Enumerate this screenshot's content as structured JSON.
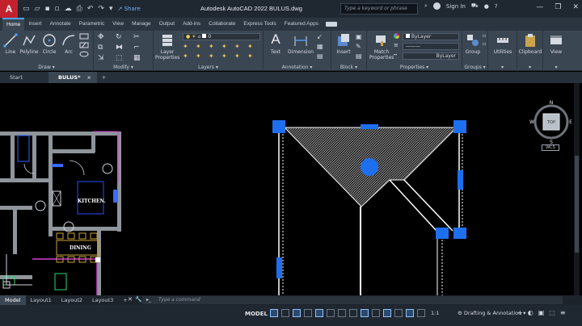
{
  "titlebar": {
    "app_letter": "A",
    "share": "Share",
    "title": "Autodesk AutoCAD 2022   BULUS.dwg",
    "search_placeholder": "Type a keyword or phrase",
    "sign_in": "Sign In",
    "min": "—",
    "max": "❐",
    "close": "✕"
  },
  "menu": {
    "tabs": [
      "Home",
      "Insert",
      "Annotate",
      "Parametric",
      "View",
      "Manage",
      "Output",
      "Add-ins",
      "Collaborate",
      "Express Tools",
      "Featured Apps"
    ],
    "active": "Home"
  },
  "ribbon": {
    "draw": {
      "label": "Draw",
      "line": "Line",
      "polyline": "Polyline",
      "circle": "Circle",
      "arc": "Arc"
    },
    "modify": {
      "label": "Modify"
    },
    "layers": {
      "label": "Layers",
      "layer_properties_l1": "Layer",
      "layer_properties_l2": "Properties",
      "layer_value": "0"
    },
    "annotation": {
      "label": "Annotation",
      "text": "Text",
      "dimension": "Dimension"
    },
    "block": {
      "label": "Block",
      "insert": "Insert"
    },
    "properties": {
      "label": "Properties",
      "match_l1": "Match",
      "match_l2": "Properties",
      "bylayer_1": "ByLayer",
      "bylayer_2": "ByLayer"
    },
    "groups": {
      "label": "Groups",
      "group": "Group"
    },
    "utilities": "Utilities",
    "clipboard": "Clipboard",
    "view": "View"
  },
  "filetabs": {
    "start": "Start",
    "bulus": "BULUS*",
    "close": "×",
    "add": "+"
  },
  "drawing": {
    "kitchen": "KITCHEN.",
    "dining": "DINING"
  },
  "viewcube": {
    "n": "N",
    "s": "S",
    "e": "E",
    "w": "W",
    "top": "TOP",
    "wcs": "WCS"
  },
  "layouts": {
    "tabs": [
      "Model",
      "Layout1",
      "Layout2",
      "Layout3"
    ],
    "active": "Model",
    "add": "+"
  },
  "command": {
    "placeholder": "Type a command"
  },
  "status": {
    "model": "MODEL",
    "scale": "1:1",
    "workspace": "Drafting & Annotation",
    "menu": "≡"
  },
  "colors": {
    "accent": "#4ea4ff",
    "grip": "#1e6ff0",
    "wall": "#9aa0a6",
    "logo": "#c4212f"
  }
}
